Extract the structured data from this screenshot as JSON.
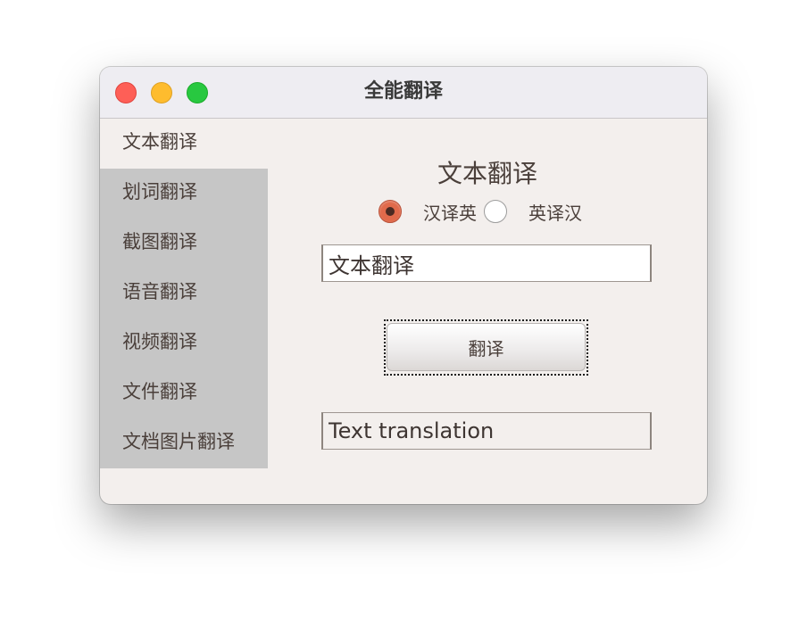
{
  "window": {
    "title": "全能翻译"
  },
  "sidebar": {
    "items": [
      {
        "label": "文本翻译"
      },
      {
        "label": "划词翻译"
      },
      {
        "label": "截图翻译"
      },
      {
        "label": "语音翻译"
      },
      {
        "label": "视频翻译"
      },
      {
        "label": "文件翻译"
      },
      {
        "label": "文档图片翻译"
      }
    ],
    "selected_index": 0
  },
  "main": {
    "heading": "文本翻译",
    "direction": {
      "options": [
        {
          "label": "汉译英",
          "checked": true
        },
        {
          "label": "英译汉",
          "checked": false
        }
      ]
    },
    "input": {
      "value": "文本翻译"
    },
    "translate_button": {
      "label": "翻译"
    },
    "output": {
      "value": "Text translation"
    }
  },
  "colors": {
    "close": "#fe5f57",
    "minimize": "#febc2e",
    "maximize": "#28c840",
    "radio_checked": "#e06a4b",
    "sidebar_background": "#c6c6c6",
    "window_background": "#f3efed"
  }
}
